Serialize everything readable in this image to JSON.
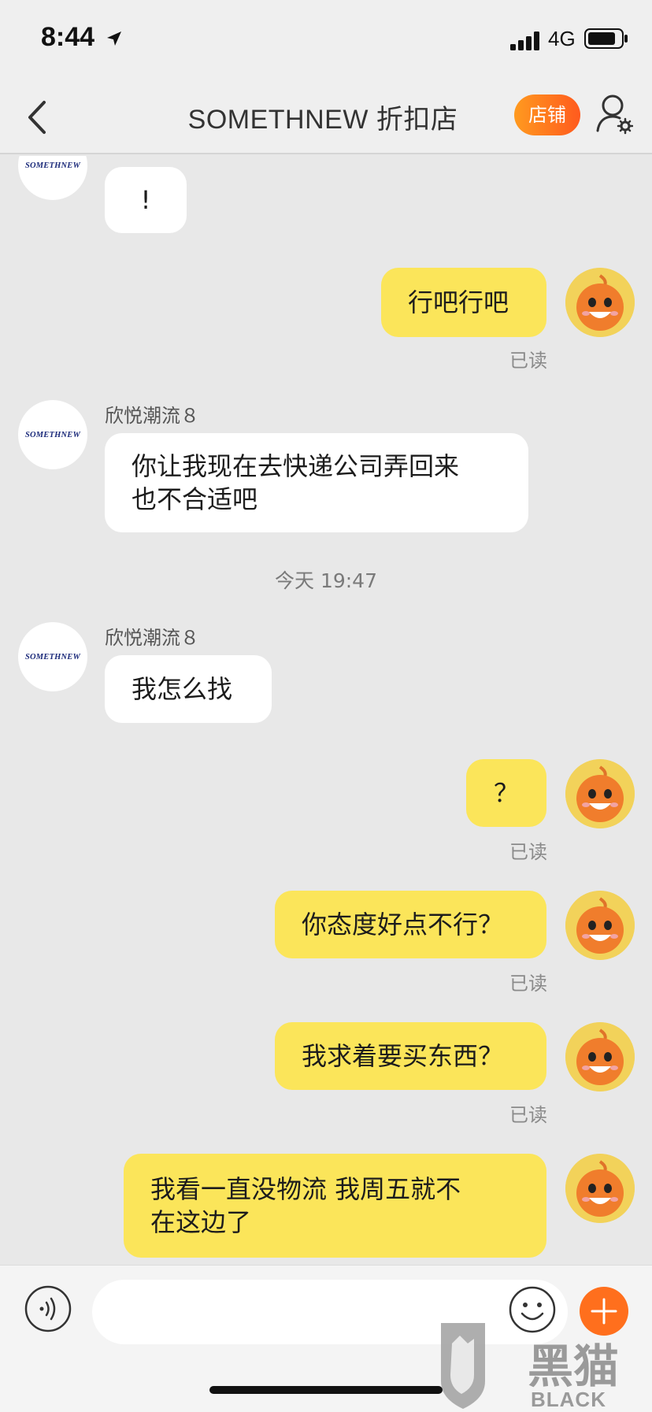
{
  "status_bar": {
    "time": "8:44",
    "network": "4G"
  },
  "header": {
    "title": "SOMETHNEW 折扣店",
    "shop_button": "店铺"
  },
  "avatars": {
    "shop_logo_text": "SOMETHNEW"
  },
  "messages": [
    {
      "from": "shop",
      "text": "!"
    },
    {
      "from": "me",
      "text": "行吧行吧",
      "status": "已读"
    },
    {
      "from": "shop",
      "sender": "欣悦潮流８",
      "text": "你让我现在去快递公司弄回来\n也不合适吧"
    },
    {
      "from": "system",
      "text": "今天 19:47"
    },
    {
      "from": "shop",
      "sender": "欣悦潮流８",
      "text": "我怎么找"
    },
    {
      "from": "me",
      "text": "？",
      "status": "已读"
    },
    {
      "from": "me",
      "text": "你态度好点不行？",
      "status": "已读"
    },
    {
      "from": "me",
      "text": "我求着要买东西？",
      "status": "已读"
    },
    {
      "from": "me",
      "text": "我看一直没物流 我周五就不\n在这边了"
    }
  ],
  "input": {
    "value": "",
    "placeholder": ""
  },
  "watermark": {
    "text": "黑猫",
    "subtext": "BLACK CAT"
  },
  "colors": {
    "bubble_out": "#fbe55a",
    "bubble_in": "#ffffff",
    "accent": "#ff6f1d"
  }
}
